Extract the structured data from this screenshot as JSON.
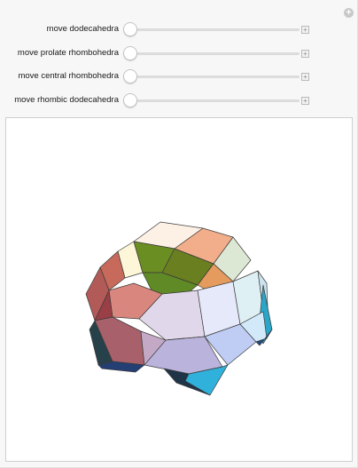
{
  "controls": {
    "sliders": [
      {
        "label": "move dodecahedra",
        "value": 0
      },
      {
        "label": "move prolate rhombohedra",
        "value": 0
      },
      {
        "label": "move central rhombohedra",
        "value": 0
      },
      {
        "label": "move rhombic dodecahedra",
        "value": 0
      }
    ],
    "reset_icon": "plus-circle-icon",
    "stepper_icon": "plus-square-icon"
  },
  "viewport": {
    "object": "rhombic triacontahedron dissection",
    "colors": {
      "olive_green": "#6b8e23",
      "salmon": "#d9837a",
      "light_lavender": "#e0d8ec",
      "cyan": "#2fb1dc",
      "navy": "#233f73"
    }
  }
}
